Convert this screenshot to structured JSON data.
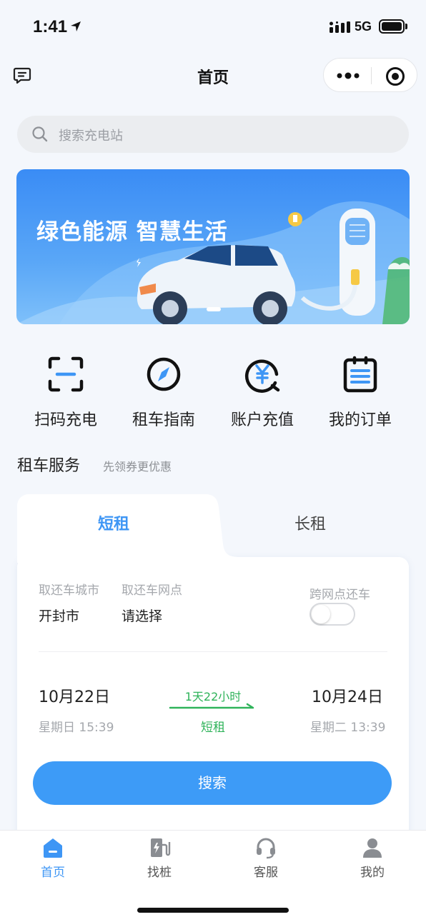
{
  "status_bar": {
    "time": "1:41",
    "network": "5G"
  },
  "nav": {
    "title": "首页"
  },
  "search": {
    "placeholder": "搜索充电站"
  },
  "banner": {
    "slogan": "绿色能源 智慧生活"
  },
  "quick_actions": [
    {
      "label": "扫码充电",
      "icon": "scan-icon"
    },
    {
      "label": "租车指南",
      "icon": "compass-icon"
    },
    {
      "label": "账户充值",
      "icon": "yuan-icon"
    },
    {
      "label": "我的订单",
      "icon": "clipboard-icon"
    }
  ],
  "rental": {
    "title": "租车服务",
    "subtitle": "先领券更优惠",
    "tabs": [
      "短租",
      "长租"
    ],
    "city_label": "取还车城市",
    "city_value": "开封市",
    "branch_label": "取还车网点",
    "branch_value": "请选择",
    "cross_label": "跨网点还车",
    "pickup_date": "10月22日",
    "pickup_time": "星期日 15:39",
    "return_date": "10月24日",
    "return_time": "星期二 13:39",
    "duration": "1天22小时",
    "duration_type": "短租",
    "search_button": "搜索"
  },
  "tabbar": [
    {
      "label": "首页",
      "icon": "home-icon"
    },
    {
      "label": "找桩",
      "icon": "charger-icon"
    },
    {
      "label": "客服",
      "icon": "headset-icon"
    },
    {
      "label": "我的",
      "icon": "user-icon"
    }
  ],
  "colors": {
    "accent": "#3e96f5",
    "green": "#2fb35a",
    "background": "#f4f7fc"
  }
}
